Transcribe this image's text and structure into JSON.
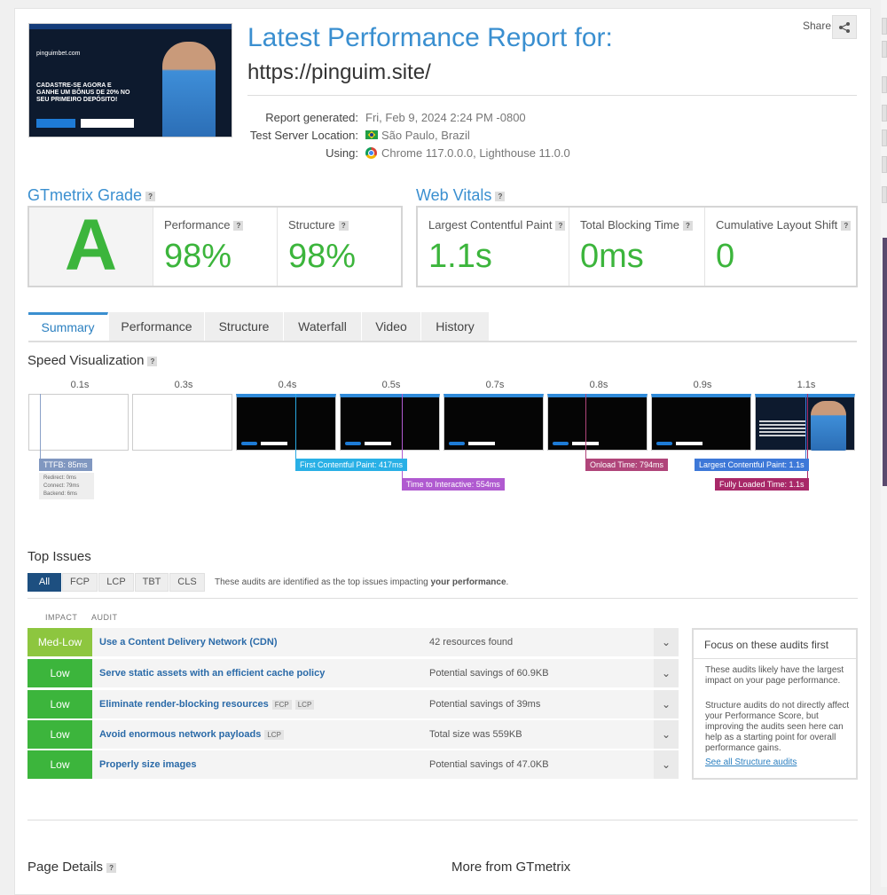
{
  "header": {
    "title": "Latest Performance Report for:",
    "url": "https://pinguim.site/",
    "share_label": "Share"
  },
  "thumbnail": {
    "logo_text": "pinguimbet.com",
    "headline": "CADASTRE-SE AGORA E GANHE UM BÔNUS DE 20% NO SEU PRIMEIRO DEPÓSITO!"
  },
  "meta": {
    "report_generated_label": "Report generated:",
    "report_generated_value": "Fri, Feb 9, 2024 2:24 PM -0800",
    "server_label": "Test Server Location:",
    "server_value": "São Paulo, Brazil",
    "using_label": "Using:",
    "using_value": "Chrome 117.0.0.0, Lighthouse 11.0.0"
  },
  "grade": {
    "heading": "GTmetrix Grade",
    "letter": "A",
    "performance_label": "Performance",
    "performance_value": "98%",
    "structure_label": "Structure",
    "structure_value": "98%"
  },
  "vitals": {
    "heading": "Web Vitals",
    "lcp_label": "Largest Contentful Paint",
    "lcp_value": "1.1s",
    "tbt_label": "Total Blocking Time",
    "tbt_value": "0ms",
    "cls_label": "Cumulative Layout Shift",
    "cls_value": "0"
  },
  "tabs": [
    "Summary",
    "Performance",
    "Structure",
    "Waterfall",
    "Video",
    "History"
  ],
  "speed": {
    "heading": "Speed Visualization",
    "times": [
      "0.1s",
      "0.3s",
      "0.4s",
      "0.5s",
      "0.7s",
      "0.8s",
      "0.9s",
      "1.1s"
    ],
    "markers": {
      "ttfb": "TTFB: 85ms",
      "redirect": "Redirect: 0ms",
      "connect": "Connect: 79ms",
      "backend": "Backend: 6ms",
      "fcp": "First Contentful Paint: 417ms",
      "tti": "Time to Interactive: 554ms",
      "onload": "Onload Time: 794ms",
      "lcp": "Largest Contentful Paint: 1.1s",
      "fully_loaded": "Fully Loaded Time: 1.1s"
    }
  },
  "issues": {
    "heading": "Top Issues",
    "filters": [
      "All",
      "FCP",
      "LCP",
      "TBT",
      "CLS"
    ],
    "note_prefix": "These audits are identified as the top issues impacting ",
    "note_bold": "your performance",
    "note_suffix": ".",
    "col_impact": "IMPACT",
    "col_audit": "AUDIT",
    "rows": [
      {
        "impact": "Med-Low",
        "audit": "Use a Content Delivery Network (CDN)",
        "result": "42 resources found"
      },
      {
        "impact": "Low",
        "audit": "Serve static assets with an efficient cache policy",
        "result": "Potential savings of 60.9KB"
      },
      {
        "impact": "Low",
        "audit": "Eliminate render-blocking resources",
        "tag1": "FCP",
        "tag2": "LCP",
        "result": "Potential savings of 39ms"
      },
      {
        "impact": "Low",
        "audit": "Avoid enormous network payloads",
        "tag1": "LCP",
        "result": "Total size was 559KB"
      },
      {
        "impact": "Low",
        "audit": "Properly size images",
        "result": "Potential savings of 47.0KB"
      }
    ]
  },
  "focus": {
    "title": "Focus on these audits first",
    "p1": "These audits likely have the largest impact on your page performance.",
    "p2": "Structure audits do not directly affect your Performance Score, but improving the audits seen here can help as a starting point for overall performance gains.",
    "link": "See all Structure audits"
  },
  "footer": {
    "page_details": "Page Details",
    "more_from": "More from GTmetrix"
  },
  "colors": {
    "accent": "#3a8fd0",
    "green": "#3cb53c",
    "medlow": "#8dc63f",
    "low": "#3cb53c"
  }
}
